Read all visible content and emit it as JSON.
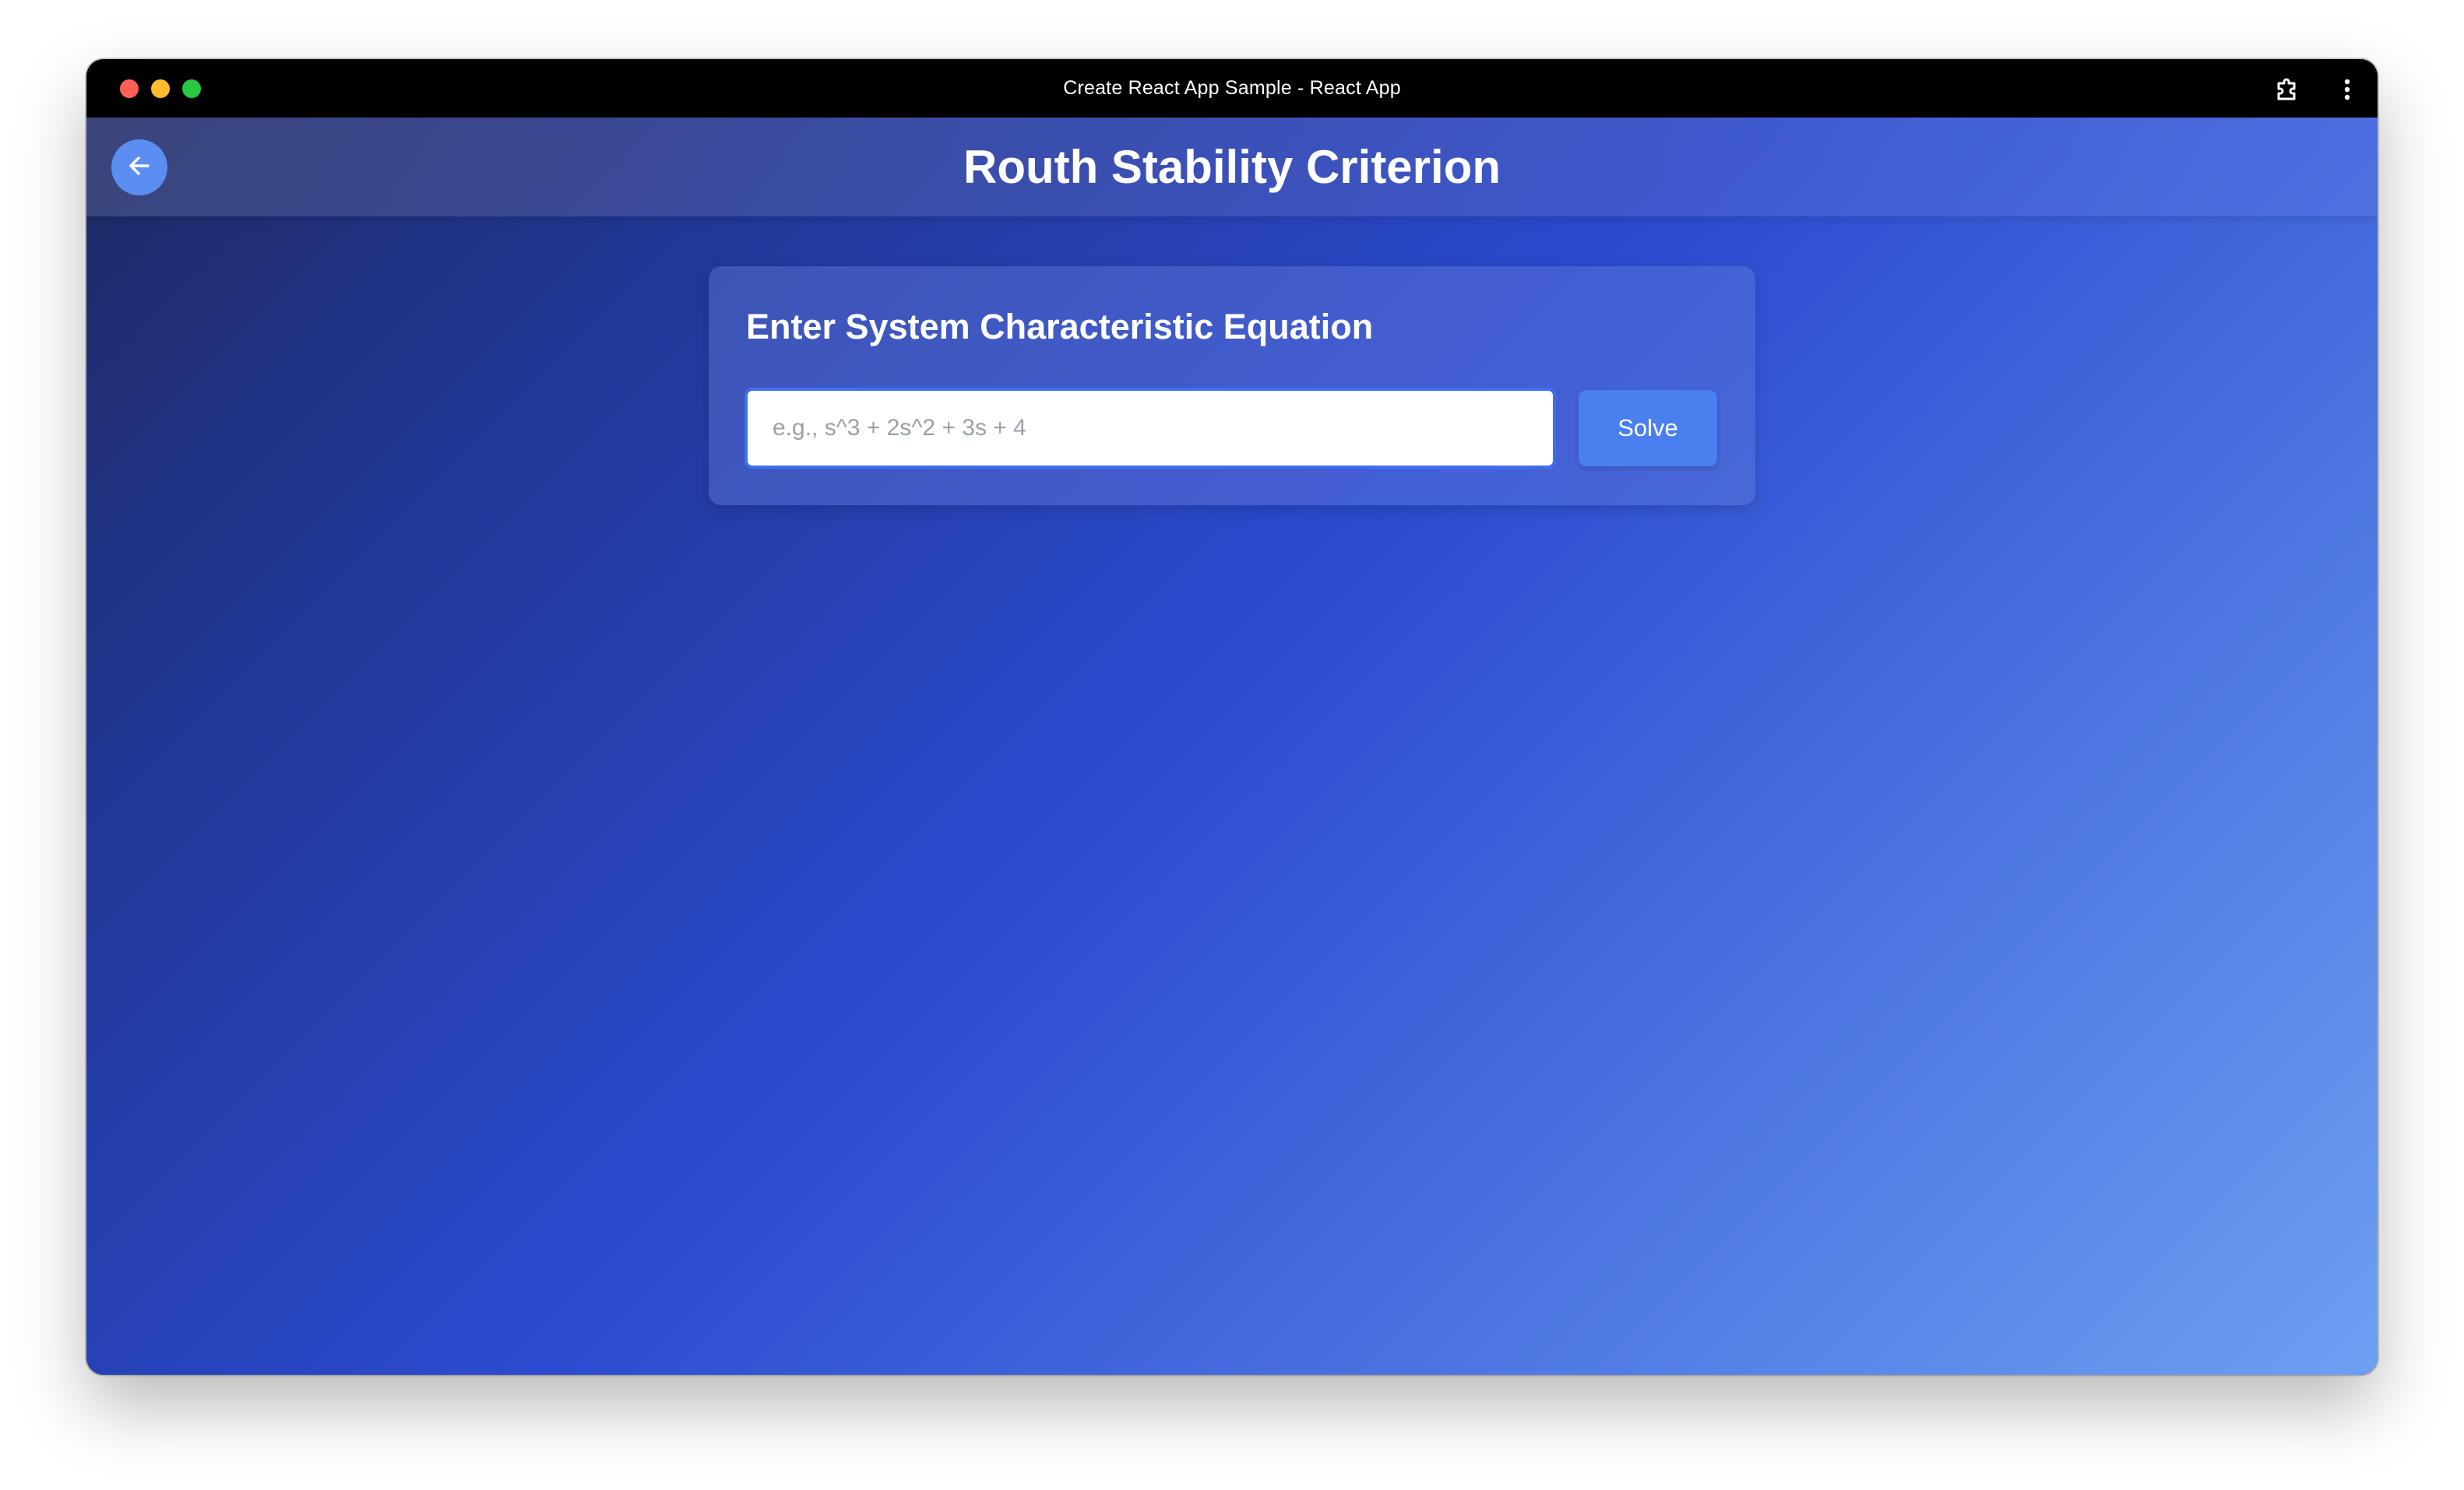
{
  "window": {
    "title": "Create React App Sample - React App"
  },
  "browser_controls": {
    "extensions_icon": "puzzle-extension-icon",
    "menu_icon": "vertical-dots-menu-icon"
  },
  "header": {
    "back_icon": "arrow-left-icon",
    "title": "Routh Stability Criterion"
  },
  "card": {
    "heading": "Enter System Characteristic Equation",
    "input": {
      "value": "",
      "placeholder": "e.g., s^3 + 2s^2 + 3s + 4"
    },
    "solve_label": "Solve"
  },
  "colors": {
    "accent": "#4a7ff0",
    "back_button": "#5b8ef0",
    "background_start": "#1e2a63",
    "background_end": "#6da0f2"
  }
}
